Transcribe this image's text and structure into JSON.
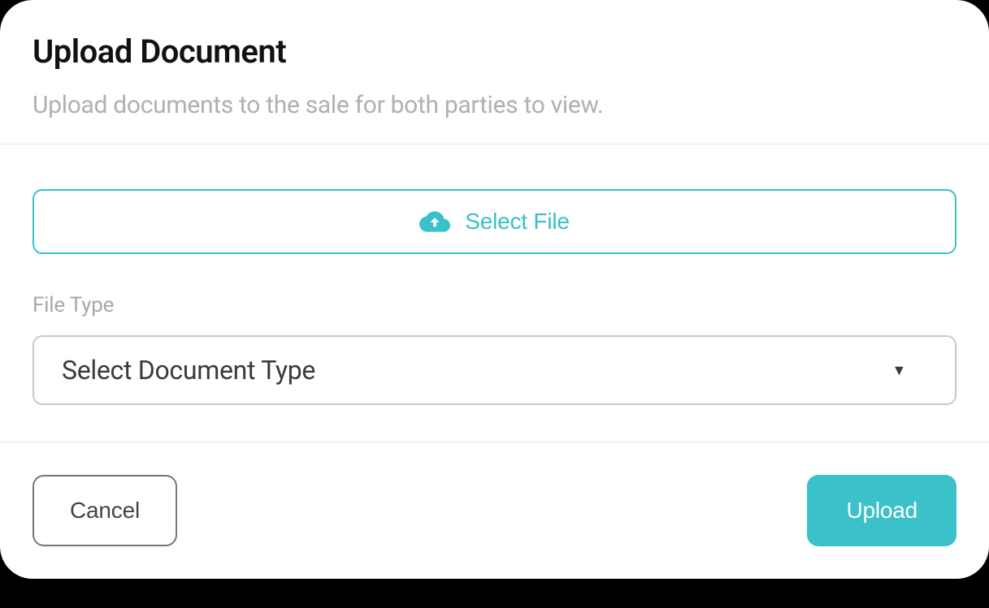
{
  "header": {
    "title": "Upload Document",
    "subtitle": "Upload documents to the sale for both parties to view."
  },
  "body": {
    "select_file_label": "Select File",
    "file_type_label": "File Type",
    "doc_type_placeholder": "Select Document Type"
  },
  "footer": {
    "cancel_label": "Cancel",
    "upload_label": "Upload"
  },
  "colors": {
    "accent": "#39c0c8"
  }
}
